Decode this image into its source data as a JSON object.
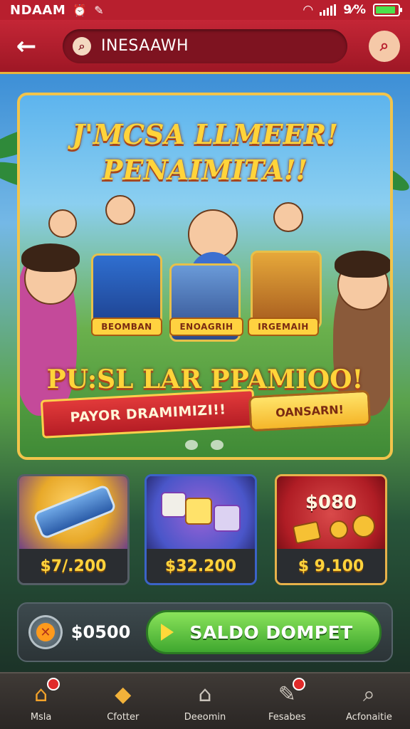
{
  "status_bar": {
    "carrier": "NDAAM",
    "battery_text": "9⁄%",
    "battery_level": 0.9,
    "icons": [
      "alarm-icon",
      "leaf-icon",
      "wifi-icon",
      "signal-icon",
      "battery-icon"
    ]
  },
  "header": {
    "back_icon": "back-arrow-icon",
    "search_text": "INESAAWH",
    "search_icon": "search-icon",
    "search_button_icon": "search-icon"
  },
  "banner": {
    "title_line1": "J'MCSA LLMEER!",
    "title_line2": "PENAIMITA!!",
    "tile_labels": [
      "BEOMBAN",
      "ENOAGRIH",
      "IRGEMAIH"
    ],
    "promo_text": "PU:SL LAR PPAMIOO!",
    "ribbon_text": "PAYOR DRAMIMIZI!!",
    "cta_label": "OANSARN!",
    "slides": 2
  },
  "cards": [
    {
      "price": "$7/.200",
      "art_price": "",
      "accent": "#e8a92a"
    },
    {
      "price": "$32.200",
      "art_price": "",
      "accent": "#4a56c9"
    },
    {
      "price": "$ 9.100",
      "art_price": "$080",
      "accent": "#c7272f"
    }
  ],
  "balance": {
    "amount": "$0500",
    "button_label": "SALDO DOMPET"
  },
  "bottom_nav": [
    {
      "label": "Msla",
      "icon": "home-icon",
      "badge": true
    },
    {
      "label": "Cfotter",
      "icon": "gift-icon",
      "badge": false
    },
    {
      "label": "Deeomin",
      "icon": "house-icon",
      "badge": false
    },
    {
      "label": "Fesabes",
      "icon": "tools-icon",
      "badge": true
    },
    {
      "label": "Acfonaitie",
      "icon": "search-icon",
      "badge": false
    }
  ]
}
